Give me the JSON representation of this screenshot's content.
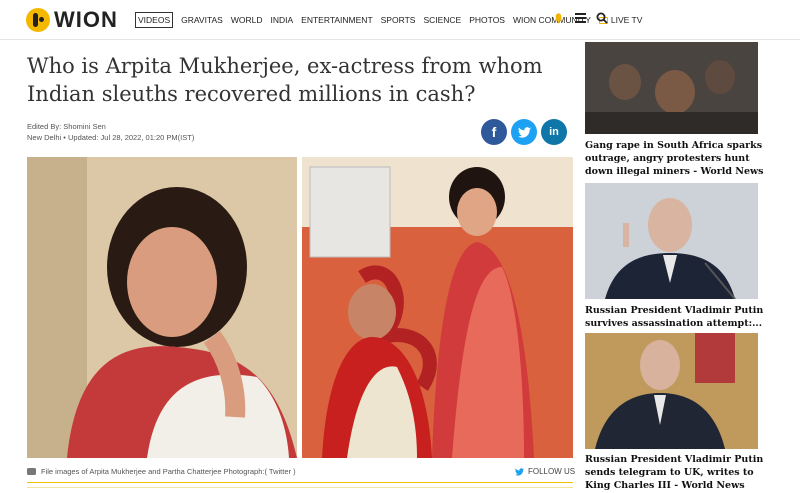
{
  "brand": {
    "name": "WION"
  },
  "nav": {
    "items": [
      "VIDEOS",
      "GRAVITAS",
      "WORLD",
      "INDIA",
      "ENTERTAINMENT",
      "SPORTS",
      "SCIENCE",
      "PHOTOS",
      "WION COMMUNITY"
    ],
    "live_label": "LIVE TV"
  },
  "article": {
    "headline": "Who is Arpita Mukherjee, ex-actress from whom Indian sleuths recovered millions in cash?",
    "edited_by": "Edited By: Shomini Sen",
    "location": "New Delhi",
    "updated": "Updated: Jul 28, 2022, 01:20 PM(IST)",
    "caption": "File images of Arpita Mukherjee and Partha Chatterjee Photograph:( Twitter )",
    "follow_label": "FOLLOW US"
  },
  "share": {
    "facebook": "f",
    "twitter": "t",
    "linkedin": "in"
  },
  "sidebar": {
    "stories": [
      {
        "title": "Gang rape in South Africa sparks outrage, angry protesters hunt down illegal miners - World News"
      },
      {
        "title": "Russian President Vladimir Putin survives assassination attempt:..."
      },
      {
        "title": "Russian President Vladimir Putin sends telegram to UK, writes to King Charles III - World News"
      }
    ]
  },
  "colors": {
    "accent": "#f5b800",
    "facebook": "#2e5a9c",
    "twitter": "#1da1f2",
    "linkedin": "#0e76a8"
  }
}
